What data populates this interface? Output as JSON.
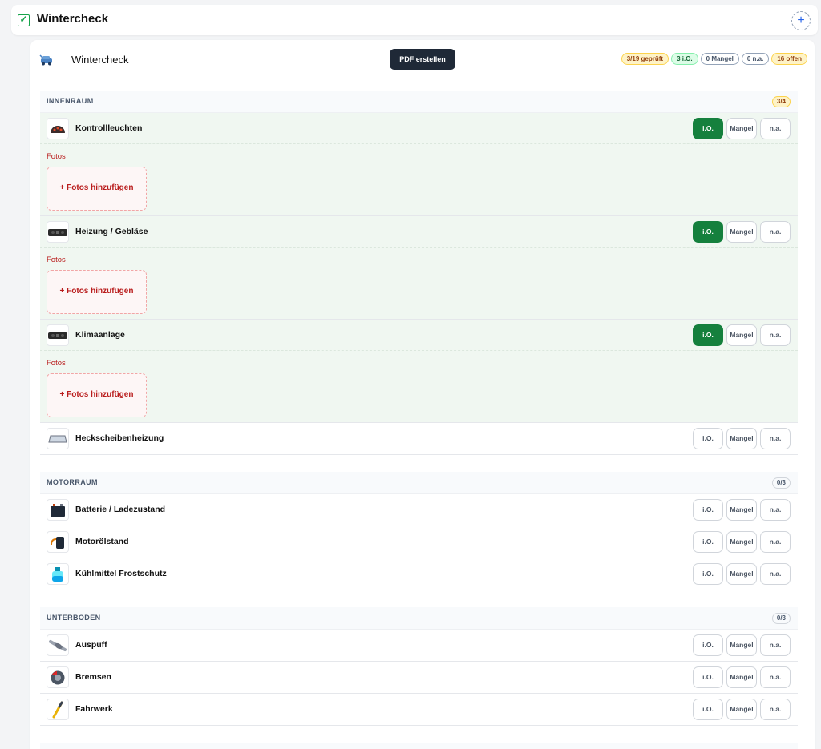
{
  "top": {
    "title": "Wintercheck",
    "check_glyph": "✓",
    "plus_glyph": "+"
  },
  "header": {
    "title": "Wintercheck",
    "pdf_label": "PDF erstellen",
    "badges": {
      "checked": "3/19 geprüft",
      "io": "3 i.O.",
      "mangel": "0 Mangel",
      "na": "0 n.a.",
      "open": "16 offen"
    }
  },
  "labels": {
    "io": "i.O.",
    "mangel": "Mangel",
    "na": "n.a.",
    "fotos": "Fotos",
    "add_photos": "+ Fotos hinzufügen"
  },
  "sections": [
    {
      "title": "INNENRAUM",
      "count": "3/4",
      "items": [
        {
          "name": "Kontrollleuchten",
          "status": "io",
          "icon": "dashboard-icon"
        },
        {
          "name": "Heizung / Gebläse",
          "status": "io",
          "icon": "climate-panel-icon"
        },
        {
          "name": "Klimaanlage",
          "status": "io",
          "icon": "climate-panel-icon"
        },
        {
          "name": "Heckscheibenheizung",
          "status": "open",
          "icon": "rear-window-icon"
        }
      ]
    },
    {
      "title": "MOTORRAUM",
      "count": "0/3",
      "items": [
        {
          "name": "Batterie / Ladezustand",
          "status": "open",
          "icon": "battery-icon"
        },
        {
          "name": "Motorölstand",
          "status": "open",
          "icon": "oil-icon"
        },
        {
          "name": "Kühlmittel Frostschutz",
          "status": "open",
          "icon": "coolant-icon"
        }
      ]
    },
    {
      "title": "UNTERBODEN",
      "count": "0/3",
      "items": [
        {
          "name": "Auspuff",
          "status": "open",
          "icon": "exhaust-icon"
        },
        {
          "name": "Bremsen",
          "status": "open",
          "icon": "brake-icon"
        },
        {
          "name": "Fahrwerk",
          "status": "open",
          "icon": "shock-absorber-icon"
        }
      ]
    }
  ],
  "colors": {
    "active_green": "#15803d",
    "ok_row_bg": "#f0f7f1",
    "photo_red": "#b91c1c"
  }
}
